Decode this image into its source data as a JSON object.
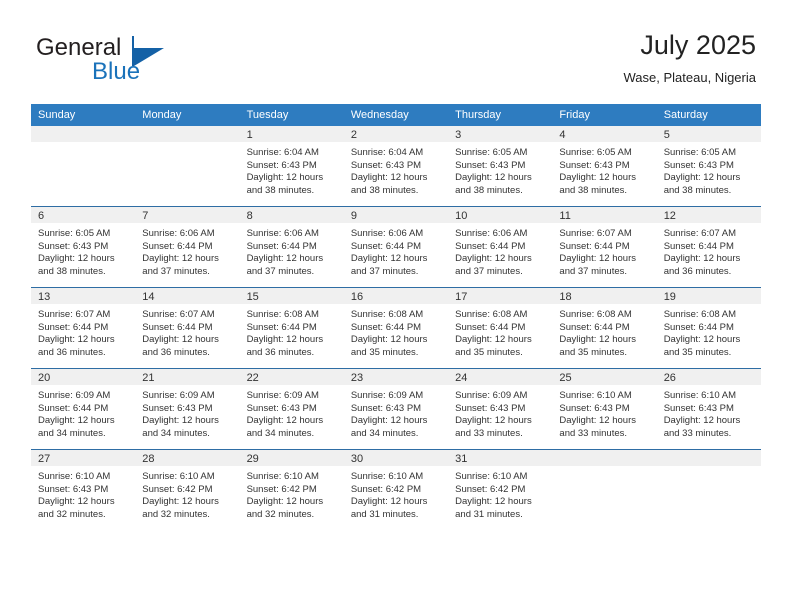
{
  "brand": {
    "name_part1": "General",
    "name_part2": "Blue",
    "accent_color": "#1461a6"
  },
  "header": {
    "title": "July 2025",
    "subtitle": "Wase, Plateau, Nigeria"
  },
  "theme": {
    "header_blue": "#2e7cc0",
    "row_divider": "#2e6da4",
    "daynum_strip": "#f0f0f0"
  },
  "weekdays": [
    "Sunday",
    "Monday",
    "Tuesday",
    "Wednesday",
    "Thursday",
    "Friday",
    "Saturday"
  ],
  "weeks": [
    [
      {
        "day": "",
        "sunrise": "",
        "sunset": "",
        "daylight1": "",
        "daylight2": ""
      },
      {
        "day": "",
        "sunrise": "",
        "sunset": "",
        "daylight1": "",
        "daylight2": ""
      },
      {
        "day": "1",
        "sunrise": "Sunrise: 6:04 AM",
        "sunset": "Sunset: 6:43 PM",
        "daylight1": "Daylight: 12 hours",
        "daylight2": "and 38 minutes."
      },
      {
        "day": "2",
        "sunrise": "Sunrise: 6:04 AM",
        "sunset": "Sunset: 6:43 PM",
        "daylight1": "Daylight: 12 hours",
        "daylight2": "and 38 minutes."
      },
      {
        "day": "3",
        "sunrise": "Sunrise: 6:05 AM",
        "sunset": "Sunset: 6:43 PM",
        "daylight1": "Daylight: 12 hours",
        "daylight2": "and 38 minutes."
      },
      {
        "day": "4",
        "sunrise": "Sunrise: 6:05 AM",
        "sunset": "Sunset: 6:43 PM",
        "daylight1": "Daylight: 12 hours",
        "daylight2": "and 38 minutes."
      },
      {
        "day": "5",
        "sunrise": "Sunrise: 6:05 AM",
        "sunset": "Sunset: 6:43 PM",
        "daylight1": "Daylight: 12 hours",
        "daylight2": "and 38 minutes."
      }
    ],
    [
      {
        "day": "6",
        "sunrise": "Sunrise: 6:05 AM",
        "sunset": "Sunset: 6:43 PM",
        "daylight1": "Daylight: 12 hours",
        "daylight2": "and 38 minutes."
      },
      {
        "day": "7",
        "sunrise": "Sunrise: 6:06 AM",
        "sunset": "Sunset: 6:44 PM",
        "daylight1": "Daylight: 12 hours",
        "daylight2": "and 37 minutes."
      },
      {
        "day": "8",
        "sunrise": "Sunrise: 6:06 AM",
        "sunset": "Sunset: 6:44 PM",
        "daylight1": "Daylight: 12 hours",
        "daylight2": "and 37 minutes."
      },
      {
        "day": "9",
        "sunrise": "Sunrise: 6:06 AM",
        "sunset": "Sunset: 6:44 PM",
        "daylight1": "Daylight: 12 hours",
        "daylight2": "and 37 minutes."
      },
      {
        "day": "10",
        "sunrise": "Sunrise: 6:06 AM",
        "sunset": "Sunset: 6:44 PM",
        "daylight1": "Daylight: 12 hours",
        "daylight2": "and 37 minutes."
      },
      {
        "day": "11",
        "sunrise": "Sunrise: 6:07 AM",
        "sunset": "Sunset: 6:44 PM",
        "daylight1": "Daylight: 12 hours",
        "daylight2": "and 37 minutes."
      },
      {
        "day": "12",
        "sunrise": "Sunrise: 6:07 AM",
        "sunset": "Sunset: 6:44 PM",
        "daylight1": "Daylight: 12 hours",
        "daylight2": "and 36 minutes."
      }
    ],
    [
      {
        "day": "13",
        "sunrise": "Sunrise: 6:07 AM",
        "sunset": "Sunset: 6:44 PM",
        "daylight1": "Daylight: 12 hours",
        "daylight2": "and 36 minutes."
      },
      {
        "day": "14",
        "sunrise": "Sunrise: 6:07 AM",
        "sunset": "Sunset: 6:44 PM",
        "daylight1": "Daylight: 12 hours",
        "daylight2": "and 36 minutes."
      },
      {
        "day": "15",
        "sunrise": "Sunrise: 6:08 AM",
        "sunset": "Sunset: 6:44 PM",
        "daylight1": "Daylight: 12 hours",
        "daylight2": "and 36 minutes."
      },
      {
        "day": "16",
        "sunrise": "Sunrise: 6:08 AM",
        "sunset": "Sunset: 6:44 PM",
        "daylight1": "Daylight: 12 hours",
        "daylight2": "and 35 minutes."
      },
      {
        "day": "17",
        "sunrise": "Sunrise: 6:08 AM",
        "sunset": "Sunset: 6:44 PM",
        "daylight1": "Daylight: 12 hours",
        "daylight2": "and 35 minutes."
      },
      {
        "day": "18",
        "sunrise": "Sunrise: 6:08 AM",
        "sunset": "Sunset: 6:44 PM",
        "daylight1": "Daylight: 12 hours",
        "daylight2": "and 35 minutes."
      },
      {
        "day": "19",
        "sunrise": "Sunrise: 6:08 AM",
        "sunset": "Sunset: 6:44 PM",
        "daylight1": "Daylight: 12 hours",
        "daylight2": "and 35 minutes."
      }
    ],
    [
      {
        "day": "20",
        "sunrise": "Sunrise: 6:09 AM",
        "sunset": "Sunset: 6:44 PM",
        "daylight1": "Daylight: 12 hours",
        "daylight2": "and 34 minutes."
      },
      {
        "day": "21",
        "sunrise": "Sunrise: 6:09 AM",
        "sunset": "Sunset: 6:43 PM",
        "daylight1": "Daylight: 12 hours",
        "daylight2": "and 34 minutes."
      },
      {
        "day": "22",
        "sunrise": "Sunrise: 6:09 AM",
        "sunset": "Sunset: 6:43 PM",
        "daylight1": "Daylight: 12 hours",
        "daylight2": "and 34 minutes."
      },
      {
        "day": "23",
        "sunrise": "Sunrise: 6:09 AM",
        "sunset": "Sunset: 6:43 PM",
        "daylight1": "Daylight: 12 hours",
        "daylight2": "and 34 minutes."
      },
      {
        "day": "24",
        "sunrise": "Sunrise: 6:09 AM",
        "sunset": "Sunset: 6:43 PM",
        "daylight1": "Daylight: 12 hours",
        "daylight2": "and 33 minutes."
      },
      {
        "day": "25",
        "sunrise": "Sunrise: 6:10 AM",
        "sunset": "Sunset: 6:43 PM",
        "daylight1": "Daylight: 12 hours",
        "daylight2": "and 33 minutes."
      },
      {
        "day": "26",
        "sunrise": "Sunrise: 6:10 AM",
        "sunset": "Sunset: 6:43 PM",
        "daylight1": "Daylight: 12 hours",
        "daylight2": "and 33 minutes."
      }
    ],
    [
      {
        "day": "27",
        "sunrise": "Sunrise: 6:10 AM",
        "sunset": "Sunset: 6:43 PM",
        "daylight1": "Daylight: 12 hours",
        "daylight2": "and 32 minutes."
      },
      {
        "day": "28",
        "sunrise": "Sunrise: 6:10 AM",
        "sunset": "Sunset: 6:42 PM",
        "daylight1": "Daylight: 12 hours",
        "daylight2": "and 32 minutes."
      },
      {
        "day": "29",
        "sunrise": "Sunrise: 6:10 AM",
        "sunset": "Sunset: 6:42 PM",
        "daylight1": "Daylight: 12 hours",
        "daylight2": "and 32 minutes."
      },
      {
        "day": "30",
        "sunrise": "Sunrise: 6:10 AM",
        "sunset": "Sunset: 6:42 PM",
        "daylight1": "Daylight: 12 hours",
        "daylight2": "and 31 minutes."
      },
      {
        "day": "31",
        "sunrise": "Sunrise: 6:10 AM",
        "sunset": "Sunset: 6:42 PM",
        "daylight1": "Daylight: 12 hours",
        "daylight2": "and 31 minutes."
      },
      {
        "day": "",
        "sunrise": "",
        "sunset": "",
        "daylight1": "",
        "daylight2": ""
      },
      {
        "day": "",
        "sunrise": "",
        "sunset": "",
        "daylight1": "",
        "daylight2": ""
      }
    ]
  ]
}
